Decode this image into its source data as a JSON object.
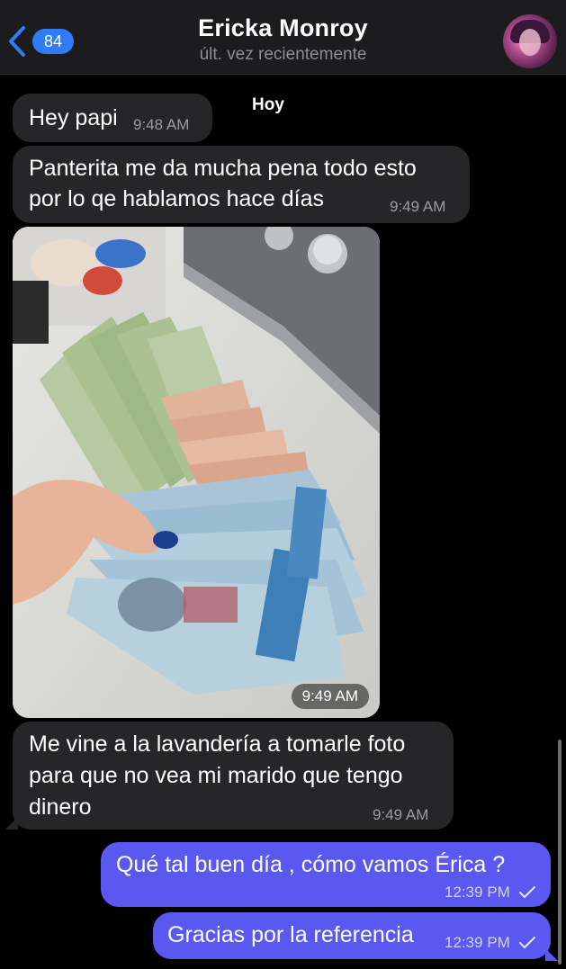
{
  "header": {
    "back_count": "84",
    "name": "Ericka Monroy",
    "status": "últ. vez recientemente"
  },
  "chat": {
    "day_label": "Hoy",
    "messages": [
      {
        "text": "Hey papi",
        "time": "9:48 AM"
      },
      {
        "text_line1": "Panterita me da mucha pena todo esto",
        "text_line2": "por lo qe hablamos hace días",
        "time": "9:49 AM"
      },
      {
        "photo_time": "9:49 AM"
      },
      {
        "line1": "Me vine a la lavandería a tomarle foto",
        "line2": "para que no vea mi marido que tengo",
        "line3": "dinero",
        "time": "9:49 AM"
      },
      {
        "text": "Qué tal buen día , cómo vamos Érica ?",
        "time": "12:39 PM"
      },
      {
        "text": "Gracias por la referencia",
        "time": "12:39 PM"
      }
    ]
  },
  "colors": {
    "incoming_bubble": "#262628",
    "outgoing_bubble": "#5a58f0",
    "accent": "#2f7cf6"
  },
  "icons": {
    "back": "chevron-left-icon",
    "read": "checkmark-icon"
  }
}
